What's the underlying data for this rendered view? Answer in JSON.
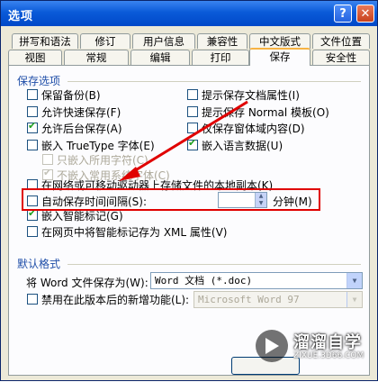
{
  "window": {
    "title": "选项",
    "help_glyph": "?",
    "close_glyph": "✕"
  },
  "tabs_row1": [
    {
      "label": "拼写和语法"
    },
    {
      "label": "修订"
    },
    {
      "label": "用户信息"
    },
    {
      "label": "兼容性"
    },
    {
      "label": "中文版式"
    },
    {
      "label": "文件位置"
    }
  ],
  "tabs_row2": [
    {
      "label": "视图"
    },
    {
      "label": "常规"
    },
    {
      "label": "编辑"
    },
    {
      "label": "打印"
    },
    {
      "label": "保存",
      "selected": true
    },
    {
      "label": "安全性"
    }
  ],
  "save_options": {
    "heading": "保存选项",
    "left": [
      {
        "label": "保留备份(B)",
        "checked": false
      },
      {
        "label": "允许快速保存(F)",
        "checked": false
      },
      {
        "label": "允许后台保存(A)",
        "checked": true
      },
      {
        "label": "嵌入 TrueType 字体(E)",
        "checked": false
      },
      {
        "label": "只嵌入所用字符(C)",
        "checked": false,
        "disabled": true
      },
      {
        "label": "不嵌入常用系统字体(C)",
        "checked": true,
        "disabled": true
      }
    ],
    "right": [
      {
        "label": "提示保存文档属性(I)",
        "checked": false
      },
      {
        "label": "提示保存 Normal 模板(O)",
        "checked": false
      },
      {
        "label": "仅保存窗体域内容(D)",
        "checked": false
      },
      {
        "label": "嵌入语言数据(U)",
        "checked": true
      }
    ],
    "network_copy": {
      "label": "在网络或可移动驱动器上存储文件的本地副本(K)",
      "checked": false
    },
    "autosave": {
      "label": "自动保存时间间隔(S):",
      "value": "",
      "unit": "分钟(M)",
      "checked": false
    },
    "embed_smart_tags": {
      "label": "嵌入智能标记(G)",
      "checked": true
    },
    "smart_tags_xml": {
      "label": "在网页中将智能标记存为 XML 属性(V)",
      "checked": false
    }
  },
  "default_format": {
    "heading": "默认格式",
    "save_as_label": "将 Word 文件保存为(W):",
    "save_as_value": "Word 文档 (*.doc)",
    "disable_features": {
      "label": "禁用在此版本后的新增功能(L):",
      "checked": false
    },
    "version_value": "Microsoft Word 97"
  },
  "watermark": {
    "title": "溜溜自学",
    "subtitle": "ZIXUE.3D66.COM"
  },
  "colors": {
    "annotation": "#e00000",
    "title_bar": "#0a5ad8",
    "group_heading": "#1f4ea8"
  }
}
